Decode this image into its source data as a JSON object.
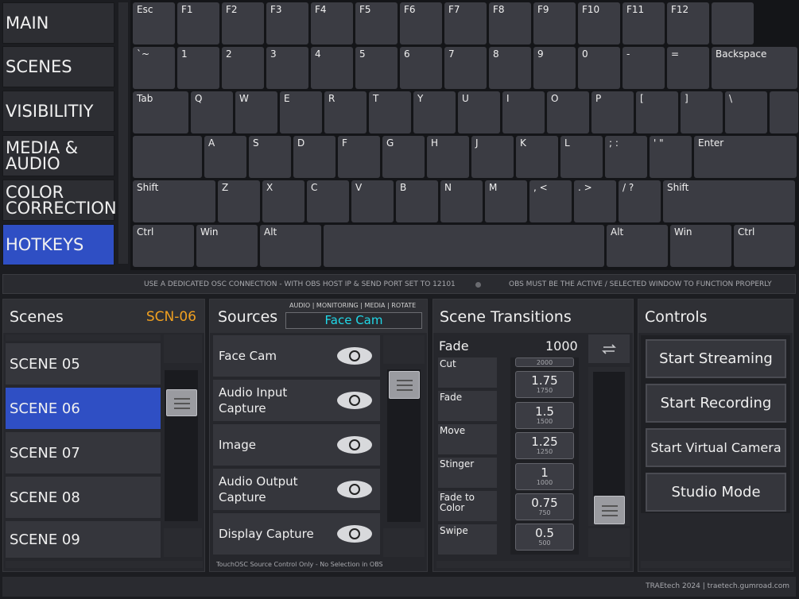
{
  "nav": {
    "items": [
      {
        "label": "MAIN",
        "active": false
      },
      {
        "label": "SCENES",
        "active": false
      },
      {
        "label": "VISIBILITIY",
        "active": false
      },
      {
        "label": "MEDIA &\nAUDIO",
        "active": false
      },
      {
        "label": "COLOR\nCORRECTION",
        "active": false
      },
      {
        "label": "HOTKEYS",
        "active": true
      }
    ]
  },
  "keyboard": {
    "rows": [
      [
        "Esc",
        "F1",
        "F2",
        "F3",
        "F4",
        "F5",
        "F6",
        "F7",
        "F8",
        "F9",
        "F10",
        "F11",
        "F12",
        ""
      ],
      [
        "`~",
        "1",
        "2",
        "3",
        "4",
        "5",
        "6",
        "7",
        "8",
        "9",
        "0",
        "-",
        "=",
        "Backspace"
      ],
      [
        "Tab",
        "Q",
        "W",
        "E",
        "R",
        "T",
        "Y",
        "U",
        "I",
        "O",
        "P",
        "[",
        "]",
        "\\",
        ""
      ],
      [
        "",
        "A",
        "S",
        "D",
        "F",
        "G",
        "H",
        "J",
        "K",
        "L",
        "; :",
        "' \"",
        "Enter"
      ],
      [
        "Shift",
        "Z",
        "X",
        "C",
        "V",
        "B",
        "N",
        "M",
        ", <",
        ". >",
        "/ ?",
        "Shift"
      ],
      [
        "Ctrl",
        "Win",
        "Alt",
        "",
        "Alt",
        "Win",
        "Ctrl"
      ]
    ]
  },
  "info": {
    "left": "USE A DEDICATED OSC CONNECTION - WITH OBS HOST IP & SEND PORT SET TO 12101",
    "right": "OBS MUST BE THE ACTIVE / SELECTED WINDOW TO FUNCTION PROPERLY"
  },
  "scenes": {
    "title": "Scenes",
    "current": "SCN-06",
    "current_color": "#f0a020",
    "items": [
      "SCENE 05",
      "SCENE 06",
      "SCENE 07",
      "SCENE 08",
      "SCENE 09"
    ],
    "active_index": 1
  },
  "sources": {
    "title": "Sources",
    "modes": "AUDIO | MONITORING | MEDIA | ROTATE",
    "selected": "Face Cam",
    "items": [
      "Face Cam",
      "Audio Input\nCapture",
      "Image",
      "Audio Output\nCapture",
      "Display Capture"
    ],
    "footnote": "TouchOSC Source Control Only - No Selection in OBS"
  },
  "transitions": {
    "title": "Scene Transitions",
    "current": "Fade",
    "duration": "1000",
    "types": [
      "Cut",
      "Fade",
      "Move",
      "Stinger",
      "Fade to\nColor",
      "Swipe"
    ],
    "partial_duration": "2000",
    "durations": [
      {
        "big": "1.75",
        "small": "1750"
      },
      {
        "big": "1.5",
        "small": "1500"
      },
      {
        "big": "1.25",
        "small": "1250"
      },
      {
        "big": "1",
        "small": "1000"
      },
      {
        "big": "0.75",
        "small": "750"
      },
      {
        "big": "0.5",
        "small": "500"
      }
    ]
  },
  "controls": {
    "title": "Controls",
    "buttons": [
      "Start Streaming",
      "Start Recording",
      "Start Virtual Camera",
      "Studio Mode"
    ]
  },
  "footer": "TRAEtech 2024  |  traetech.gumroad.com",
  "colors": {
    "accent": "#2f4fc4",
    "selected_source": "#20d8e8",
    "scene_code": "#f0a020"
  }
}
